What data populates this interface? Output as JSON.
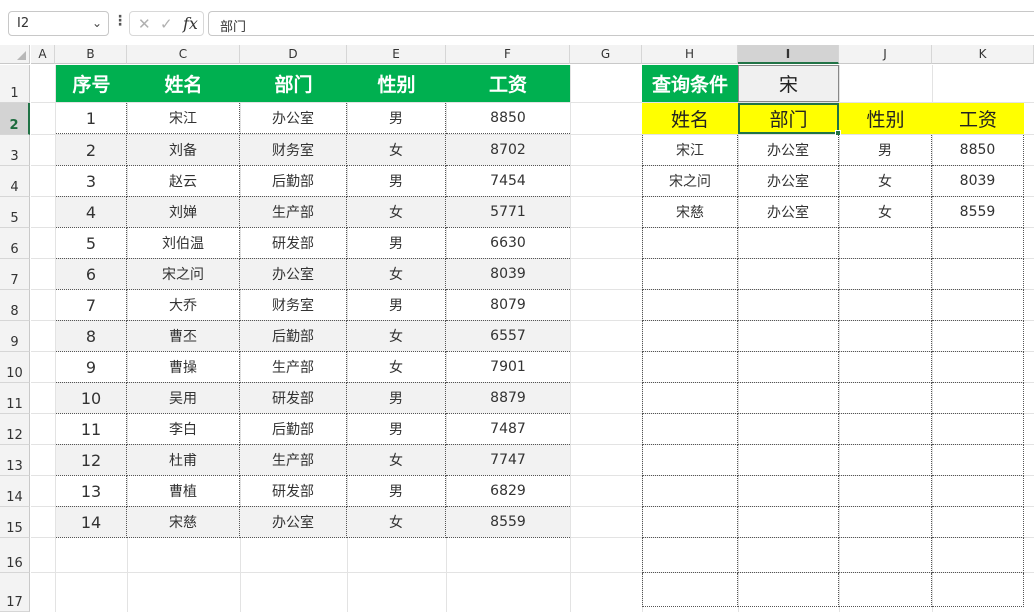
{
  "formula_bar": {
    "name_box": "I2",
    "formula": "部门"
  },
  "columns": [
    "A",
    "B",
    "C",
    "D",
    "E",
    "F",
    "G",
    "H",
    "I",
    "J",
    "K"
  ],
  "rows": [
    "1",
    "2",
    "3",
    "4",
    "5",
    "6",
    "7",
    "8",
    "9",
    "10",
    "11",
    "12",
    "13",
    "14",
    "15",
    "16",
    "17"
  ],
  "employee_table": {
    "headers": [
      "序号",
      "姓名",
      "部门",
      "性别",
      "工资"
    ],
    "rows": [
      [
        "1",
        "宋江",
        "办公室",
        "男",
        "8850"
      ],
      [
        "2",
        "刘备",
        "财务室",
        "女",
        "8702"
      ],
      [
        "3",
        "赵云",
        "后勤部",
        "男",
        "7454"
      ],
      [
        "4",
        "刘婵",
        "生产部",
        "女",
        "5771"
      ],
      [
        "5",
        "刘伯温",
        "研发部",
        "男",
        "6630"
      ],
      [
        "6",
        "宋之问",
        "办公室",
        "女",
        "8039"
      ],
      [
        "7",
        "大乔",
        "财务室",
        "男",
        "8079"
      ],
      [
        "8",
        "曹丕",
        "后勤部",
        "女",
        "6557"
      ],
      [
        "9",
        "曹操",
        "生产部",
        "女",
        "7901"
      ],
      [
        "10",
        "吴用",
        "研发部",
        "男",
        "8879"
      ],
      [
        "11",
        "李白",
        "后勤部",
        "男",
        "7487"
      ],
      [
        "12",
        "杜甫",
        "生产部",
        "女",
        "7747"
      ],
      [
        "13",
        "曹植",
        "研发部",
        "男",
        "6829"
      ],
      [
        "14",
        "宋慈",
        "办公室",
        "女",
        "8559"
      ]
    ]
  },
  "query": {
    "label": "查询条件",
    "value": "宋"
  },
  "result_table": {
    "headers": [
      "姓名",
      "部门",
      "性别",
      "工资"
    ],
    "rows": [
      [
        "宋江",
        "办公室",
        "男",
        "8850"
      ],
      [
        "宋之问",
        "办公室",
        "女",
        "8039"
      ],
      [
        "宋慈",
        "办公室",
        "女",
        "8559"
      ]
    ]
  },
  "colors": {
    "header_green": "#00b050",
    "header_yellow": "#ffff00",
    "selection_green": "#217346"
  }
}
